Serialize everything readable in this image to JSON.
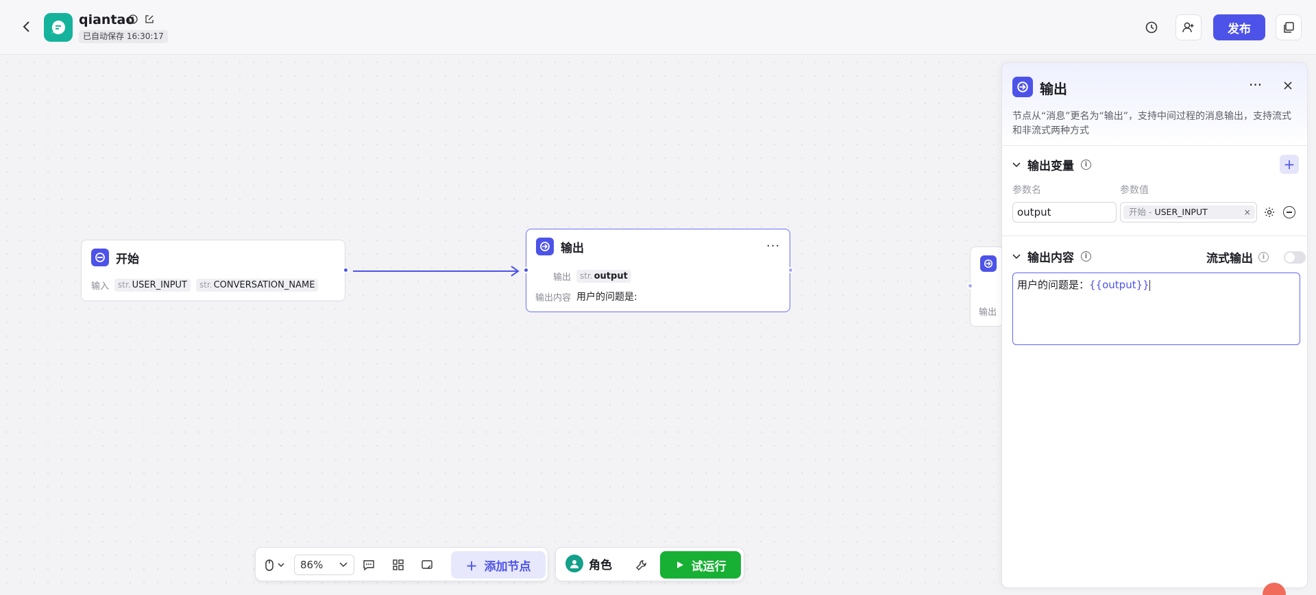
{
  "header": {
    "app_name": "qiantao",
    "autosave_text": "已自动保存 16:30:17",
    "publish_label": "发布"
  },
  "nodes": {
    "start": {
      "title": "开始",
      "input_label": "输入",
      "inputs": [
        {
          "type": "str.",
          "name": "USER_INPUT"
        },
        {
          "type": "str.",
          "name": "CONVERSATION_NAME"
        }
      ]
    },
    "output": {
      "title": "输出",
      "output_label": "输出",
      "output_var_type": "str.",
      "output_var_name": "output",
      "content_label": "输出内容",
      "content_value": "用户的问题是:"
    },
    "ghost": {
      "label": "输出"
    }
  },
  "toolbar": {
    "zoom_value": "86%",
    "add_node_label": "添加节点",
    "role_label": "角色",
    "trial_run_label": "试运行"
  },
  "panel": {
    "title": "输出",
    "description": "节点从“消息”更名为“输出”，支持中间过程的消息输出，支持流式和非流式两种方式",
    "output_vars_section": "输出变量",
    "col_param_name": "参数名",
    "col_param_value": "参数值",
    "param_name_value": "output",
    "param_source": "开始 -",
    "param_source_var": "USER_INPUT",
    "output_content_section": "输出内容",
    "stream_output_label": "流式输出",
    "editor_text": "用户的问题是：",
    "editor_var": "{{output}}"
  },
  "colors": {
    "accent": "#4d53e8",
    "app_logo": "#15b39c",
    "run_button": "#17b034"
  }
}
